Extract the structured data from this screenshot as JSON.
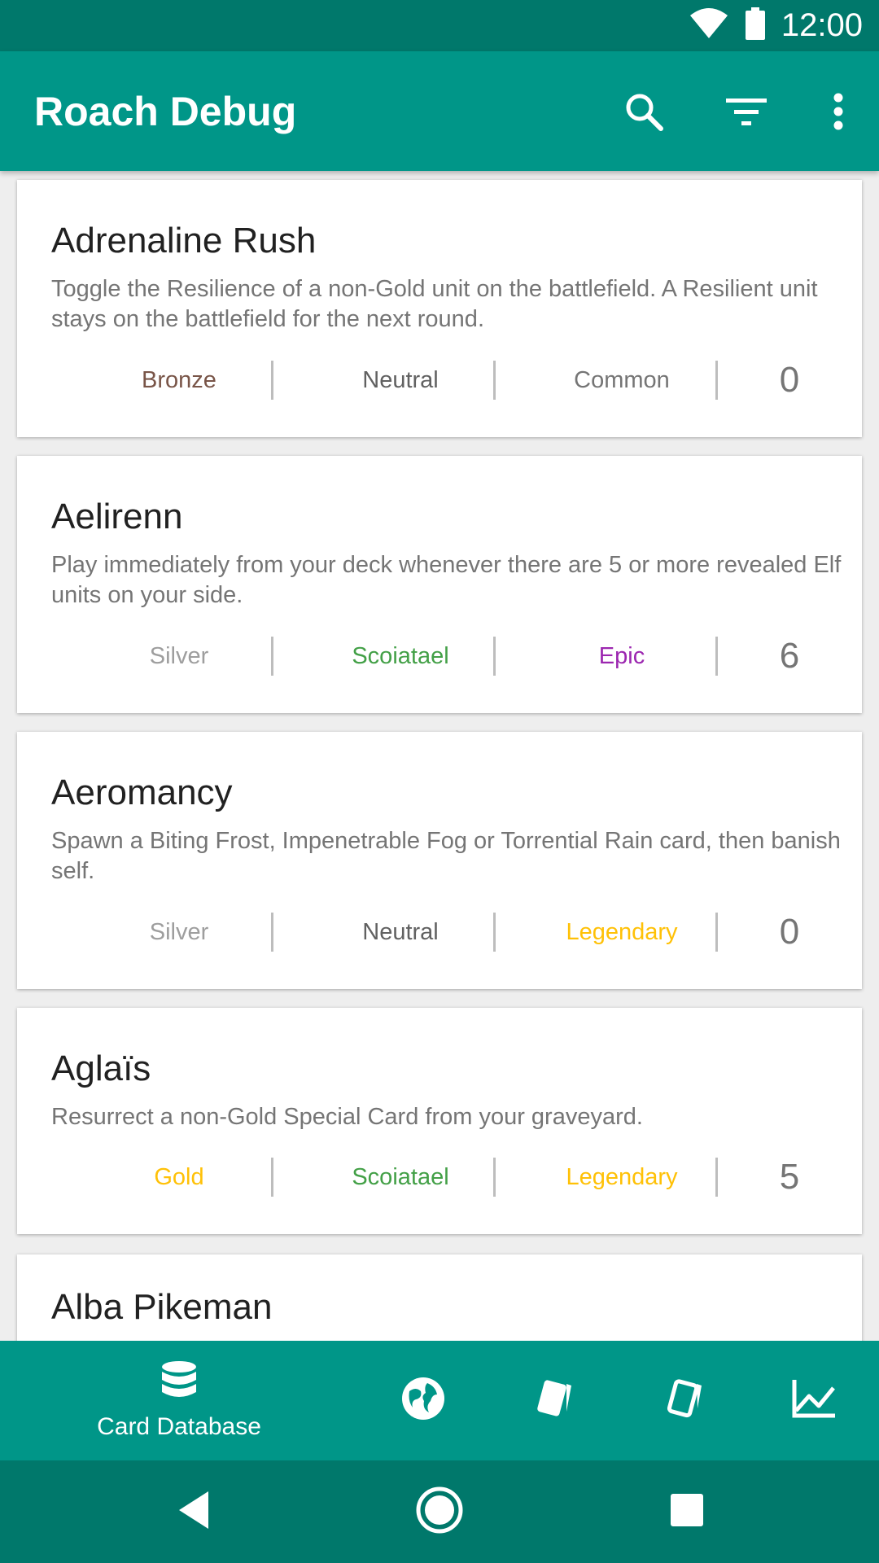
{
  "status_bar": {
    "time": "12:00"
  },
  "app_bar": {
    "title": "Roach Debug",
    "icons": [
      "search-icon",
      "filter-icon",
      "more-vert-icon"
    ]
  },
  "colors": {
    "primary": "#009688",
    "primary_dark": "#00786b",
    "bronze": "#795548",
    "silver": "#9e9e9e",
    "gold": "#ffc107",
    "neutral": "#616161",
    "scoiatael": "#43a047",
    "common": "#757575",
    "epic": "#9c27b0",
    "legendary": "#ffc107"
  },
  "cards": [
    {
      "name": "Adrenaline Rush",
      "description": "Toggle the Resilience of a non-Gold unit on the battlefield. A Resilient unit stays on the battlefield for the next round.",
      "color": "Bronze",
      "faction": "Neutral",
      "rarity": "Common",
      "provision": "0"
    },
    {
      "name": "Aelirenn",
      "description": "Play immediately from your deck whenever there are 5 or more revealed Elf units on your side.",
      "color": "Silver",
      "faction": "Scoiatael",
      "rarity": "Epic",
      "provision": "6"
    },
    {
      "name": "Aeromancy",
      "description": "Spawn a Biting Frost, Impenetrable Fog or Torrential Rain card, then banish self.",
      "color": "Silver",
      "faction": "Neutral",
      "rarity": "Legendary",
      "provision": "0"
    },
    {
      "name": "Aglaïs",
      "description": "Resurrect a non-Gold Special Card from your graveyard.",
      "color": "Gold",
      "faction": "Scoiatael",
      "rarity": "Legendary",
      "provision": "5"
    },
    {
      "name": "Alba Pikeman",
      "description": "",
      "color": "",
      "faction": "",
      "rarity": "",
      "provision": ""
    }
  ],
  "bottom_nav": {
    "active_label": "Card Database",
    "items": [
      "database-icon",
      "globe-icon",
      "card-icon",
      "card-outline-icon",
      "chart-icon"
    ]
  },
  "system_nav": {
    "icons": [
      "back-icon",
      "home-icon",
      "recents-icon"
    ]
  }
}
